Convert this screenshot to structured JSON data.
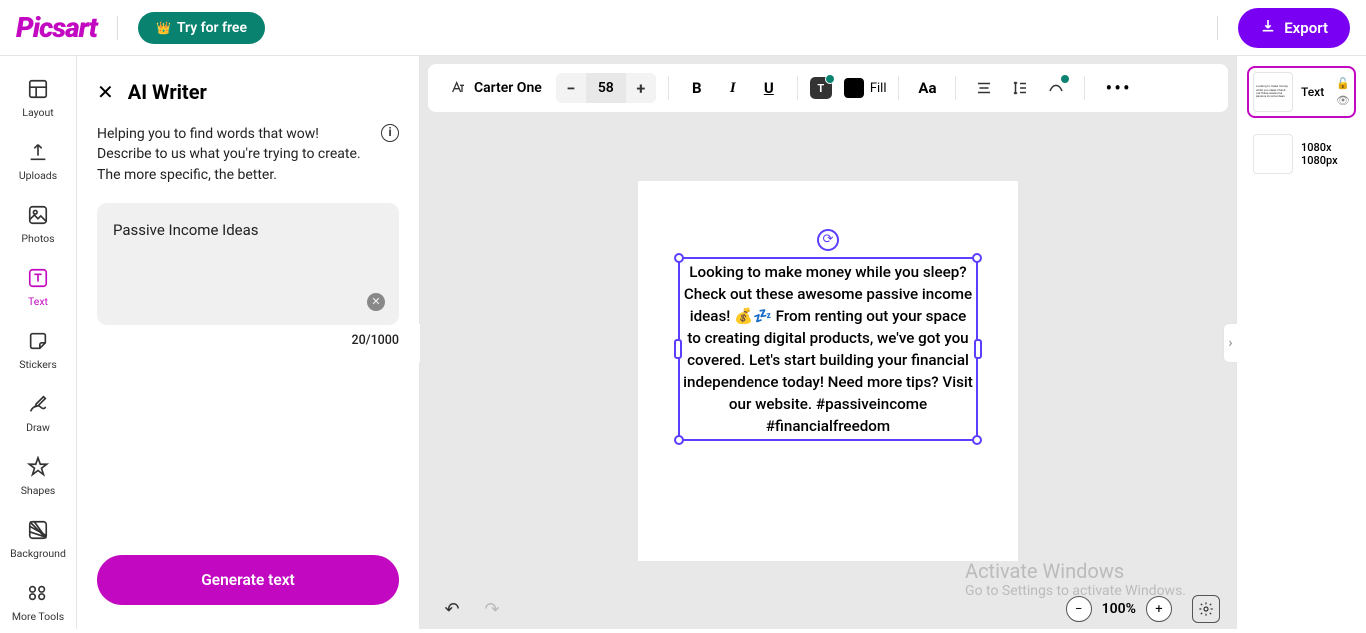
{
  "header": {
    "logo": "Picsart",
    "try_free": "Try for free",
    "export": "Export"
  },
  "rail": {
    "layout": "Layout",
    "uploads": "Uploads",
    "photos": "Photos",
    "text": "Text",
    "stickers": "Stickers",
    "draw": "Draw",
    "shapes": "Shapes",
    "background": "Background",
    "more": "More Tools"
  },
  "ai": {
    "title": "AI Writer",
    "desc": "Helping you to find words that wow! Describe to us what you're trying to create. The more specific, the better.",
    "input": "Passive Income Ideas",
    "count": "20/1000",
    "generate": "Generate text"
  },
  "toolbar": {
    "font": "Carter One",
    "size": "58",
    "fill": "Fill",
    "aa": "Aa"
  },
  "canvas": {
    "text": "Looking to make money while you sleep? Check out these awesome passive income ideas! 💰💤 From renting out your space to creating digital products, we've got you covered. Let's start building your financial independence today! Need more tips? Visit our website. #passiveincome #financialfreedom"
  },
  "layers": {
    "text_label": "Text",
    "size_label": "1080x 1080px"
  },
  "zoom": {
    "value": "100%"
  },
  "watermark": {
    "title": "Activate Windows",
    "sub": "Go to Settings to activate Windows."
  }
}
